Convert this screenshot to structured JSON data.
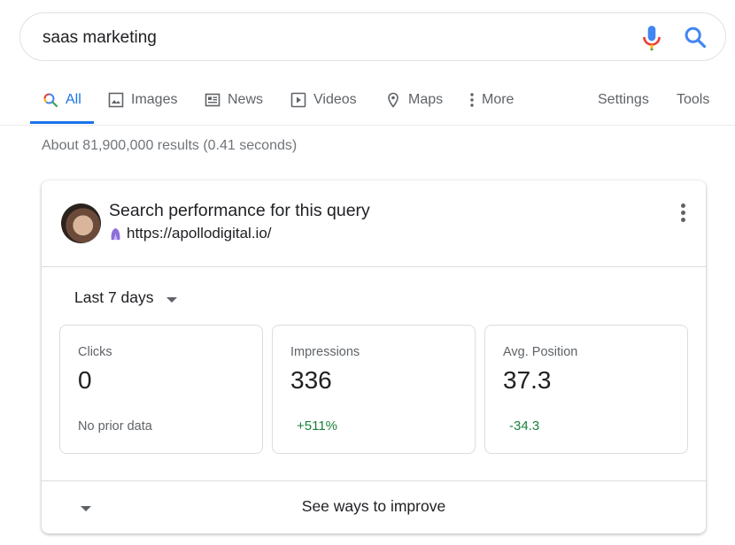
{
  "search": {
    "query": "saas marketing"
  },
  "tabs": [
    {
      "label": "All",
      "icon": "search-icon",
      "active": true
    },
    {
      "label": "Images",
      "icon": "image-icon"
    },
    {
      "label": "News",
      "icon": "news-icon"
    },
    {
      "label": "Videos",
      "icon": "video-icon"
    },
    {
      "label": "Maps",
      "icon": "map-pin-icon"
    },
    {
      "label": "More",
      "icon": "more-vertical-icon"
    },
    {
      "label": "Settings"
    },
    {
      "label": "Tools"
    }
  ],
  "results_stats": "About 81,900,000 results (0.41 seconds)",
  "card": {
    "title": "Search performance for this query",
    "site": "https://apollodigital.io/",
    "range": "Last 7 days",
    "metrics": [
      {
        "label": "Clicks",
        "value": "0",
        "sub": "No prior data"
      },
      {
        "label": "Impressions",
        "value": "336",
        "sub": "+511%"
      },
      {
        "label": "Avg. Position",
        "value": "37.3",
        "sub": "-34.3"
      }
    ],
    "improve": "See ways to improve"
  },
  "colors": {
    "accent": "#1a73e8",
    "positive": "#188038",
    "muted": "#5f6368"
  }
}
